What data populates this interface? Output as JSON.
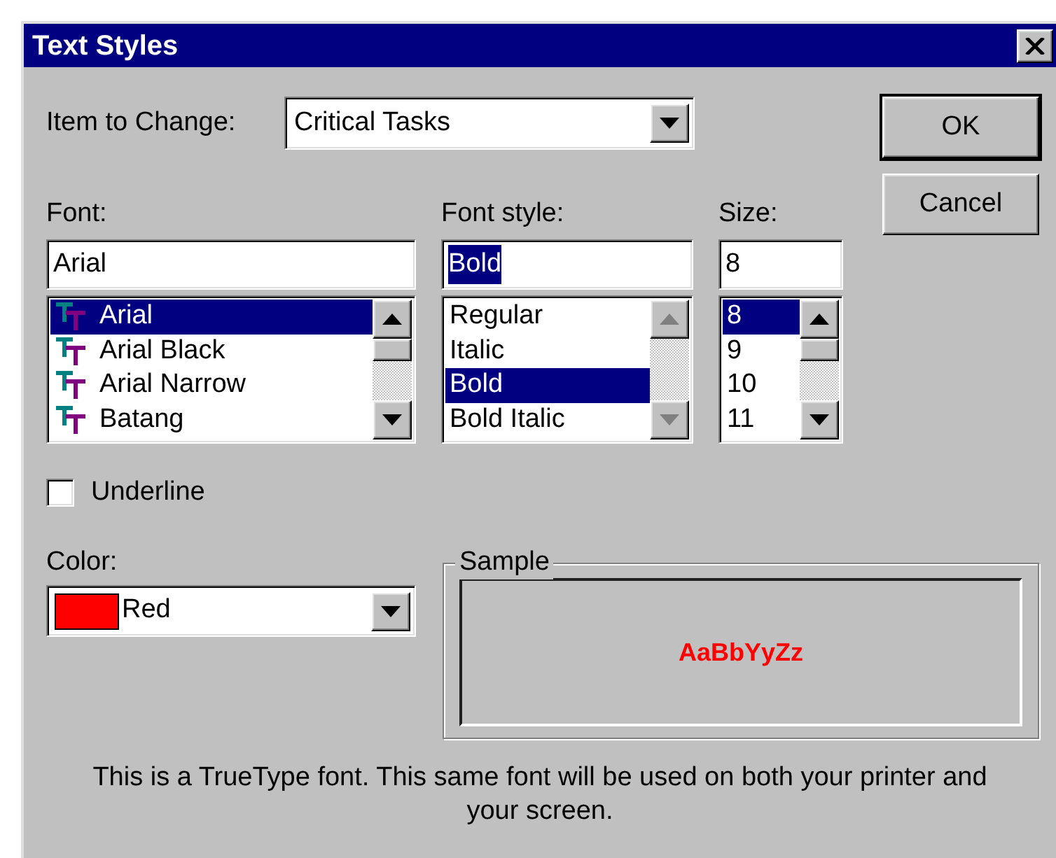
{
  "window": {
    "title": "Text Styles"
  },
  "item_to_change": {
    "label": "Item to Change:",
    "value": "Critical Tasks"
  },
  "buttons": [
    {
      "label": "OK",
      "default": true
    },
    {
      "label": "Cancel",
      "default": false
    }
  ],
  "font": {
    "label": "Font:",
    "value": "Arial",
    "value_highlighted": false,
    "scrollbar_enabled": true,
    "items": [
      {
        "label": "Arial",
        "kind": "truetype",
        "selected": true
      },
      {
        "label": "Arial Black",
        "kind": "truetype",
        "selected": false
      },
      {
        "label": "Arial Narrow",
        "kind": "truetype",
        "selected": false
      },
      {
        "label": "Batang",
        "kind": "truetype",
        "selected": false
      }
    ]
  },
  "font_style": {
    "label": "Font style:",
    "value": "Bold",
    "value_highlighted": true,
    "scrollbar_enabled": false,
    "items": [
      {
        "label": "Regular",
        "selected": false
      },
      {
        "label": "Italic",
        "selected": false
      },
      {
        "label": "Bold",
        "selected": true
      },
      {
        "label": "Bold Italic",
        "selected": false
      }
    ]
  },
  "size": {
    "label": "Size:",
    "value": "8",
    "value_highlighted": false,
    "scrollbar_enabled": true,
    "items": [
      {
        "label": "8",
        "selected": true
      },
      {
        "label": "9",
        "selected": false
      },
      {
        "label": "10",
        "selected": false
      },
      {
        "label": "11",
        "selected": false
      }
    ]
  },
  "underline": {
    "label": "Underline",
    "checked": false
  },
  "color": {
    "label": "Color:",
    "value": "Red",
    "color": "#ff0000"
  },
  "sample": {
    "label": "Sample",
    "text": "AaBbYyZz"
  },
  "note": "This is a TrueType font. This same font will be used on both your printer and your screen."
}
